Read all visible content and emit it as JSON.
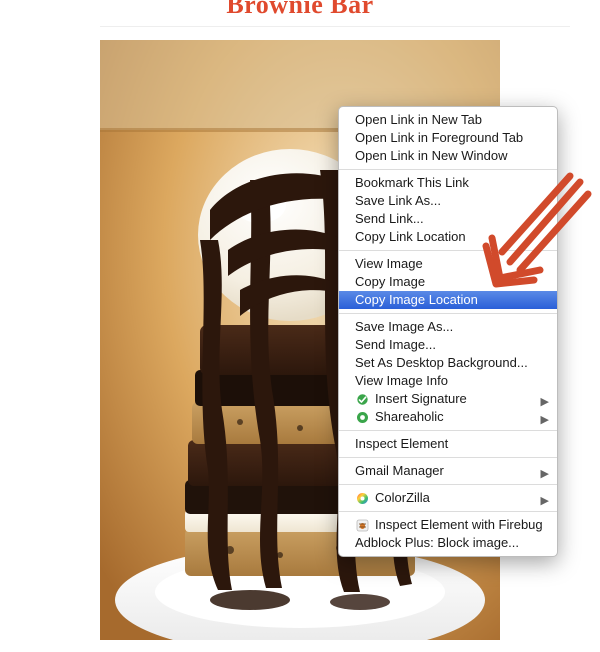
{
  "heading": "Brownie Bar",
  "contextMenu": {
    "groups": [
      {
        "items": [
          {
            "label": "Open Link in New Tab",
            "submenu": false,
            "highlight": false,
            "icon": null
          },
          {
            "label": "Open Link in Foreground Tab",
            "submenu": false,
            "highlight": false,
            "icon": null
          },
          {
            "label": "Open Link in New Window",
            "submenu": false,
            "highlight": false,
            "icon": null
          }
        ]
      },
      {
        "items": [
          {
            "label": "Bookmark This Link",
            "submenu": false,
            "highlight": false,
            "icon": null
          },
          {
            "label": "Save Link As...",
            "submenu": false,
            "highlight": false,
            "icon": null
          },
          {
            "label": "Send Link...",
            "submenu": false,
            "highlight": false,
            "icon": null
          },
          {
            "label": "Copy Link Location",
            "submenu": false,
            "highlight": false,
            "icon": null
          }
        ]
      },
      {
        "items": [
          {
            "label": "View Image",
            "submenu": false,
            "highlight": false,
            "icon": null
          },
          {
            "label": "Copy Image",
            "submenu": false,
            "highlight": false,
            "icon": null
          },
          {
            "label": "Copy Image Location",
            "submenu": false,
            "highlight": true,
            "icon": null
          }
        ]
      },
      {
        "items": [
          {
            "label": "Save Image As...",
            "submenu": false,
            "highlight": false,
            "icon": null
          },
          {
            "label": "Send Image...",
            "submenu": false,
            "highlight": false,
            "icon": null
          },
          {
            "label": "Set As Desktop Background...",
            "submenu": false,
            "highlight": false,
            "icon": null
          },
          {
            "label": "View Image Info",
            "submenu": false,
            "highlight": false,
            "icon": null
          },
          {
            "label": "Insert Signature",
            "submenu": true,
            "highlight": false,
            "icon": "insert-signature-icon"
          },
          {
            "label": "Shareaholic",
            "submenu": true,
            "highlight": false,
            "icon": "shareaholic-icon"
          }
        ]
      },
      {
        "items": [
          {
            "label": "Inspect Element",
            "submenu": false,
            "highlight": false,
            "icon": null
          }
        ]
      },
      {
        "items": [
          {
            "label": "Gmail Manager",
            "submenu": true,
            "highlight": false,
            "icon": null
          }
        ]
      },
      {
        "items": [
          {
            "label": "ColorZilla",
            "submenu": true,
            "highlight": false,
            "icon": "colorzilla-icon"
          }
        ]
      },
      {
        "items": [
          {
            "label": "Inspect Element with Firebug",
            "submenu": false,
            "highlight": false,
            "icon": "firebug-icon"
          },
          {
            "label": "Adblock Plus: Block image...",
            "submenu": false,
            "highlight": false,
            "icon": null
          }
        ]
      }
    ]
  },
  "annotation": {
    "color": "#D14A2B"
  }
}
